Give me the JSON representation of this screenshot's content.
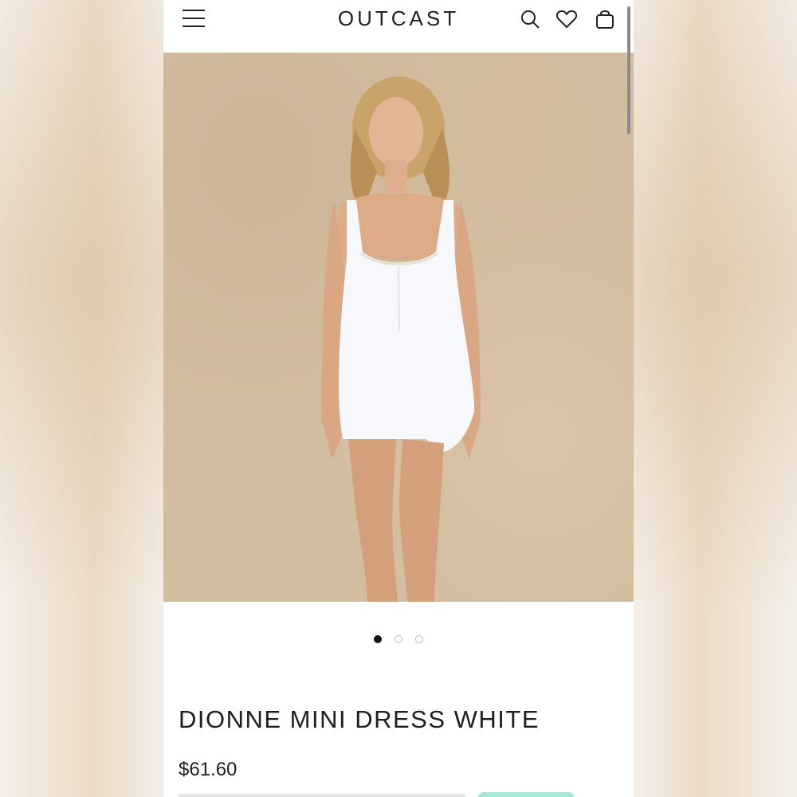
{
  "header": {
    "logo": "OUTCAST",
    "icons": [
      "menu-icon",
      "search-icon",
      "heart-icon",
      "bag-icon"
    ]
  },
  "gallery": {
    "image_count": 3,
    "active_index": 0,
    "image_description_icon": "product-photo"
  },
  "product": {
    "title": "DIONNE MINI DRESS WHITE",
    "price": "$61.60"
  },
  "colors": {
    "text": "#1e1e1e",
    "accent": "#a8e6d6"
  }
}
